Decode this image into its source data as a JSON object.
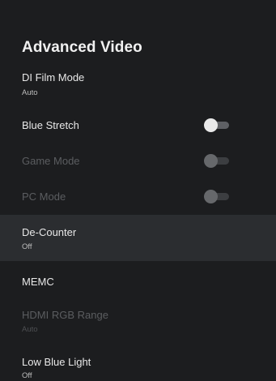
{
  "page": {
    "title": "Advanced Video"
  },
  "settings": [
    {
      "label": "DI Film Mode",
      "value": "Auto",
      "enabled": true
    },
    {
      "label": "Blue Stretch",
      "toggle": "off",
      "enabled": true
    },
    {
      "label": "Game Mode",
      "toggle": "off",
      "enabled": false
    },
    {
      "label": "PC Mode",
      "toggle": "off",
      "enabled": false
    },
    {
      "label": "De-Counter",
      "value": "Off",
      "enabled": true,
      "focused": true
    },
    {
      "label": "MEMC",
      "enabled": true
    },
    {
      "label": "HDMI RGB Range",
      "value": "Auto",
      "enabled": false
    },
    {
      "label": "Low Blue Light",
      "value": "Off",
      "enabled": true
    }
  ],
  "icons": {
    "toggle": "toggle-switch-icon"
  },
  "colors": {
    "background": "#1c1d1f",
    "focused_row": "#2b2d30",
    "text": "#e8e8e8",
    "disabled_text": "#5b5d60"
  }
}
